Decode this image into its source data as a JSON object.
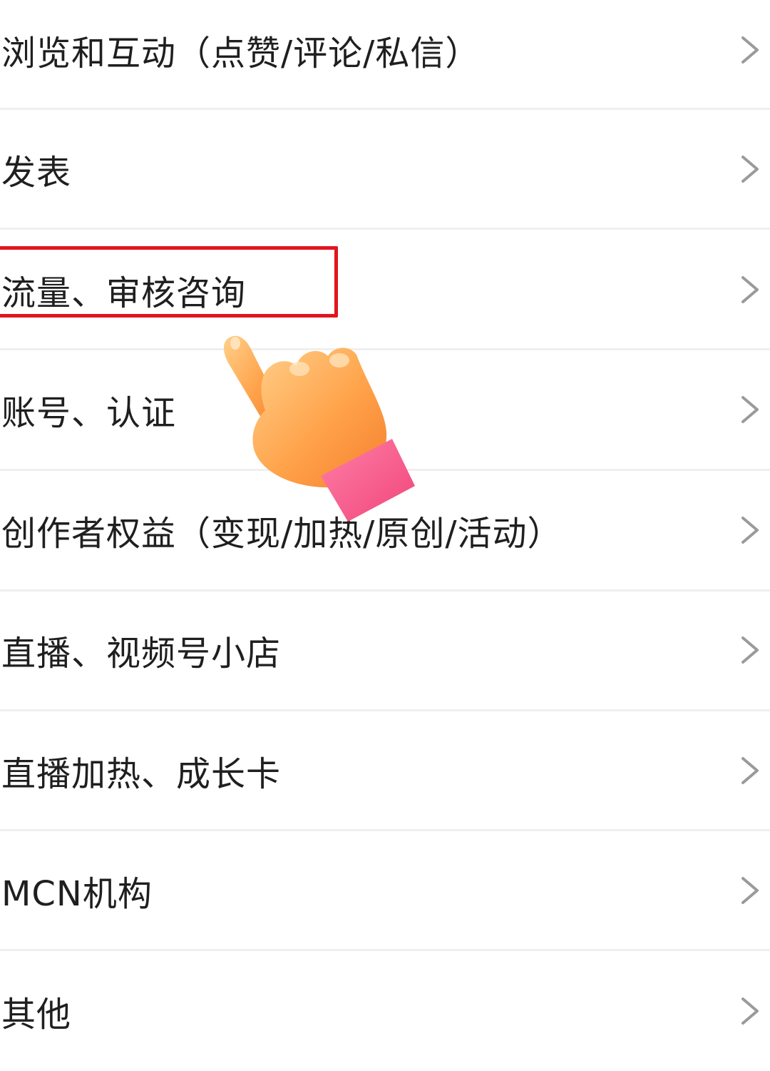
{
  "menu": {
    "items": [
      {
        "label": "浏览和互动（点赞/评论/私信）",
        "chevron": "chevron-right-icon"
      },
      {
        "label": "发表",
        "chevron": "chevron-right-icon"
      },
      {
        "label": "流量、审核咨询",
        "chevron": "chevron-right-icon",
        "highlighted": true
      },
      {
        "label": "账号、认证",
        "chevron": "chevron-right-icon"
      },
      {
        "label": "创作者权益（变现/加热/原创/活动）",
        "chevron": "chevron-right-icon"
      },
      {
        "label": "直播、视频号小店",
        "chevron": "chevron-right-icon"
      },
      {
        "label": "直播加热、成长卡",
        "chevron": "chevron-right-icon"
      },
      {
        "label": "MCN机构",
        "chevron": "chevron-right-icon"
      },
      {
        "label": "其他",
        "chevron": "chevron-right-icon"
      }
    ]
  },
  "overlay": {
    "highlight_color": "#e3141f",
    "pointer_icon": "pointing-hand-icon"
  }
}
